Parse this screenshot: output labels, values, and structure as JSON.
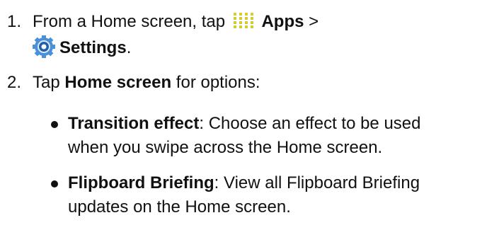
{
  "steps": [
    {
      "number": "1.",
      "line1_prefix": "From a Home screen, tap",
      "apps_label": "Apps",
      "arrow": ">",
      "settings_label": "Settings",
      "end_period": "."
    },
    {
      "number": "2.",
      "prefix": "Tap",
      "bold": "Home screen",
      "suffix": "for options:"
    }
  ],
  "bullets": [
    {
      "title": "Transition effect",
      "line1": ": Choose an effect to be used",
      "line2": "when you swipe across the Home screen."
    },
    {
      "title": "Flipboard Briefing",
      "line1": ": View all Flipboard Briefing",
      "line2": "updates on the Home screen."
    }
  ],
  "icons": {
    "apps": "apps-grid-icon",
    "settings": "settings-gear-icon"
  },
  "colors": {
    "text": "#111111",
    "apps_icon": "#d6cc2f",
    "settings_outer": "#4a90d9",
    "settings_inner": "#1f5fae"
  }
}
